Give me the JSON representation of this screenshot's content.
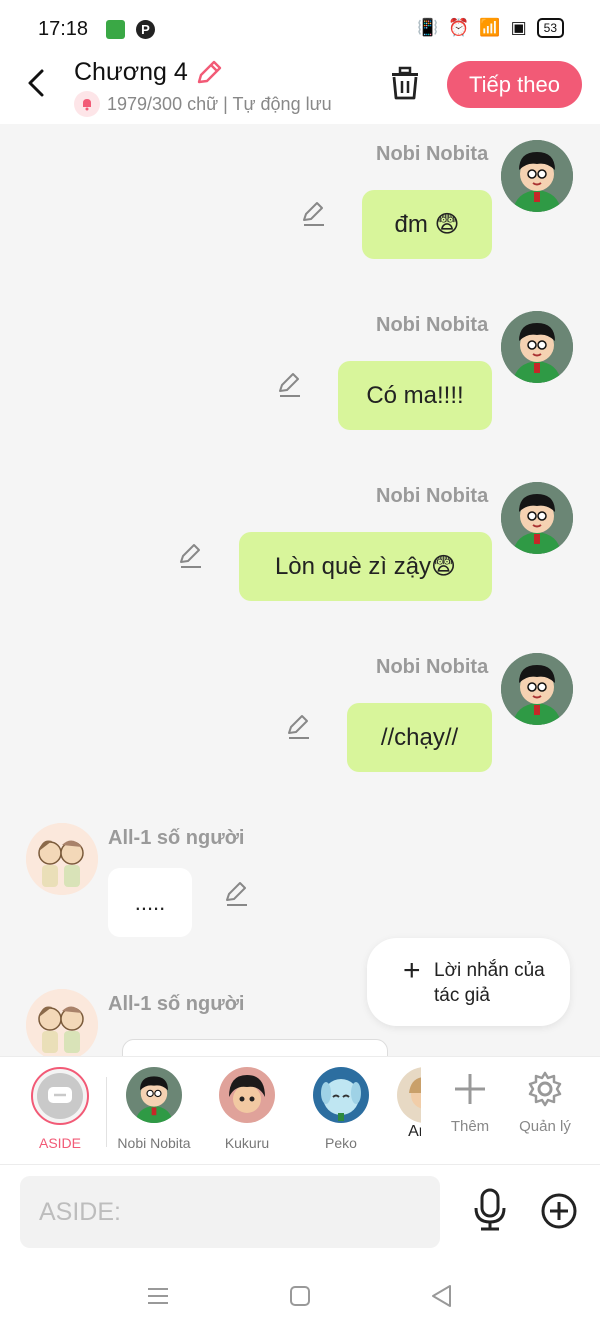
{
  "status_bar": {
    "time": "17:18",
    "battery": "53"
  },
  "header": {
    "title": "Chương 4",
    "subtitle": "1979/300 chữ | Tự động lưu",
    "next_button": "Tiếp theo"
  },
  "messages": [
    {
      "sender": "Nobi Nobita",
      "text": "đm 😨"
    },
    {
      "sender": "Nobi Nobita",
      "text": "Có ma!!!!"
    },
    {
      "sender": "Nobi Nobita",
      "text": "Lòn què zì zậy😨"
    },
    {
      "sender": "Nobi Nobita",
      "text": "//chạy//"
    },
    {
      "sender": "All-1 số người",
      "text": "....."
    },
    {
      "sender": "All-1 số người",
      "text": ""
    }
  ],
  "author_note_button": "Lời nhắn của tác giả",
  "characters": [
    {
      "name": "ASIDE",
      "selected": true
    },
    {
      "name": "Nobi Nobita"
    },
    {
      "name": "Kukuru"
    },
    {
      "name": "Peko"
    },
    {
      "name": "Aron"
    }
  ],
  "tools": {
    "add": "Thêm",
    "manage": "Quản lý"
  },
  "input": {
    "placeholder": "ASIDE:"
  },
  "colors": {
    "accent": "#f25a76",
    "my_bubble": "#d8f59b",
    "other_bubble": "#ffffff",
    "background": "#f5f5f5"
  }
}
